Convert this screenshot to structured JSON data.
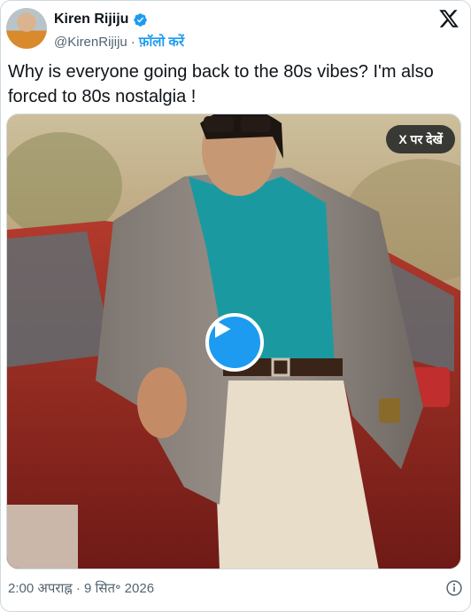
{
  "author": {
    "name": "Kiren Rijiju",
    "handle": "@KirenRijiju",
    "separator": "·",
    "follow_label": "फ़ॉलो करें"
  },
  "tweet": {
    "text": "Why is everyone going back to the 80s vibes? I'm also forced to 80s nostalgia !"
  },
  "media": {
    "watch_on_x_label": "X पर देखें"
  },
  "footer": {
    "timestamp": "2:00 अपराह्न · 9 सित॰ 2026"
  },
  "icons": {
    "verified": "verified-badge-icon",
    "brand": "x-logo-icon",
    "play": "play-icon",
    "info": "info-icon"
  },
  "colors": {
    "accent": "#1d9bf0",
    "text": "#0f1419",
    "muted": "#536471",
    "border": "#cfd9de"
  }
}
